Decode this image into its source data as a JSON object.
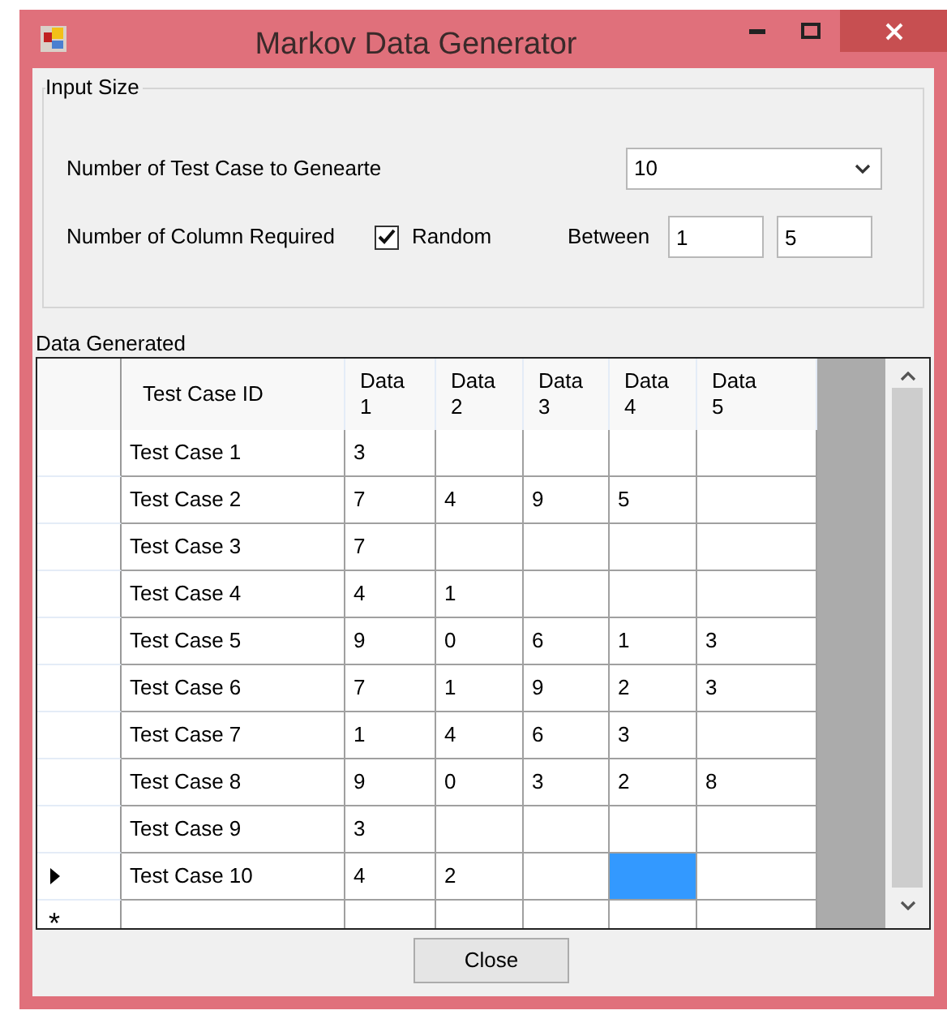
{
  "window": {
    "title": "Markov Data Generator"
  },
  "input_size": {
    "title": "Input Size",
    "test_case_label": "Number of Test Case to Genearte",
    "test_case_count": "10",
    "column_label": "Number of Column Required",
    "random": {
      "label": "Random",
      "checked": true
    },
    "between_label": "Between",
    "between_min": "1",
    "between_max": "5"
  },
  "data_generated": {
    "title": "Data Generated",
    "columns": [
      {
        "line1": "Test Case ID"
      },
      {
        "line1": "Data",
        "line2": "1"
      },
      {
        "line1": "Data",
        "line2": "2"
      },
      {
        "line1": "Data",
        "line2": "3"
      },
      {
        "line1": "Data",
        "line2": "4"
      },
      {
        "line1": "Data",
        "line2": "5"
      }
    ],
    "rows": [
      {
        "current": false,
        "cells": [
          {
            "text": "Test Case 1",
            "selected": false
          },
          {
            "text": "3",
            "selected": false
          },
          {
            "selected": false
          },
          {
            "selected": false
          },
          {
            "selected": false
          },
          {
            "selected": false
          }
        ]
      },
      {
        "current": false,
        "cells": [
          {
            "text": "Test Case 2",
            "selected": false
          },
          {
            "text": "7",
            "selected": false
          },
          {
            "text": "4",
            "selected": false
          },
          {
            "text": "9",
            "selected": false
          },
          {
            "text": "5",
            "selected": false
          },
          {
            "selected": false
          }
        ]
      },
      {
        "current": false,
        "cells": [
          {
            "text": "Test Case 3",
            "selected": false
          },
          {
            "text": "7",
            "selected": false
          },
          {
            "selected": false
          },
          {
            "selected": false
          },
          {
            "selected": false
          },
          {
            "selected": false
          }
        ]
      },
      {
        "current": false,
        "cells": [
          {
            "text": "Test Case 4",
            "selected": false
          },
          {
            "text": "4",
            "selected": false
          },
          {
            "text": "1",
            "selected": false
          },
          {
            "selected": false
          },
          {
            "selected": false
          },
          {
            "selected": false
          }
        ]
      },
      {
        "current": false,
        "cells": [
          {
            "text": "Test Case 5",
            "selected": false
          },
          {
            "text": "9",
            "selected": false
          },
          {
            "text": "0",
            "selected": false
          },
          {
            "text": "6",
            "selected": false
          },
          {
            "text": "1",
            "selected": false
          },
          {
            "text": "3",
            "selected": false
          }
        ]
      },
      {
        "current": false,
        "cells": [
          {
            "text": "Test Case 6",
            "selected": false
          },
          {
            "text": "7",
            "selected": false
          },
          {
            "text": "1",
            "selected": false
          },
          {
            "text": "9",
            "selected": false
          },
          {
            "text": "2",
            "selected": false
          },
          {
            "text": "3",
            "selected": false
          }
        ]
      },
      {
        "current": false,
        "cells": [
          {
            "text": "Test Case 7",
            "selected": false
          },
          {
            "text": "1",
            "selected": false
          },
          {
            "text": "4",
            "selected": false
          },
          {
            "text": "6",
            "selected": false
          },
          {
            "text": "3",
            "selected": false
          },
          {
            "selected": false
          }
        ]
      },
      {
        "current": false,
        "cells": [
          {
            "text": "Test Case 8",
            "selected": false
          },
          {
            "text": "9",
            "selected": false
          },
          {
            "text": "0",
            "selected": false
          },
          {
            "text": "3",
            "selected": false
          },
          {
            "text": "2",
            "selected": false
          },
          {
            "text": "8",
            "selected": false
          }
        ]
      },
      {
        "current": false,
        "cells": [
          {
            "text": "Test Case 9",
            "selected": false
          },
          {
            "text": "3",
            "selected": false
          },
          {
            "selected": false
          },
          {
            "selected": false
          },
          {
            "selected": false
          },
          {
            "selected": false
          }
        ]
      },
      {
        "current": true,
        "cells": [
          {
            "text": "Test Case 10",
            "selected": false
          },
          {
            "text": "4",
            "selected": false
          },
          {
            "text": "2",
            "selected": false
          },
          {
            "selected": false
          },
          {
            "selected": true
          },
          {
            "selected": false
          }
        ]
      }
    ],
    "new_row_marker": "*"
  },
  "buttons": [
    {
      "label": "Close"
    }
  ]
}
